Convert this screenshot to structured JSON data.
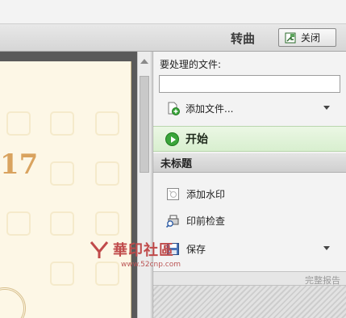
{
  "toolbar": {
    "title": "转曲",
    "close_label": "关闭"
  },
  "document": {
    "visible_number": "17"
  },
  "panel": {
    "files_label": "要处理的文件:",
    "file_input_value": "",
    "add_file_label": "添加文件...",
    "start_label": "开始",
    "section_title": "未标题",
    "actions": [
      {
        "label": "添加水印",
        "icon": "watermark-icon"
      },
      {
        "label": "印前检查",
        "icon": "preflight-icon"
      },
      {
        "label": "保存",
        "icon": "save-icon"
      }
    ],
    "report_link": "完整报告"
  },
  "watermark": {
    "text": "華印社區",
    "url": "www.52cnp.com"
  },
  "colors": {
    "start_green": "#3aa53a",
    "doc_gold": "#d9a35f",
    "page_cream": "#fdf7e6"
  }
}
